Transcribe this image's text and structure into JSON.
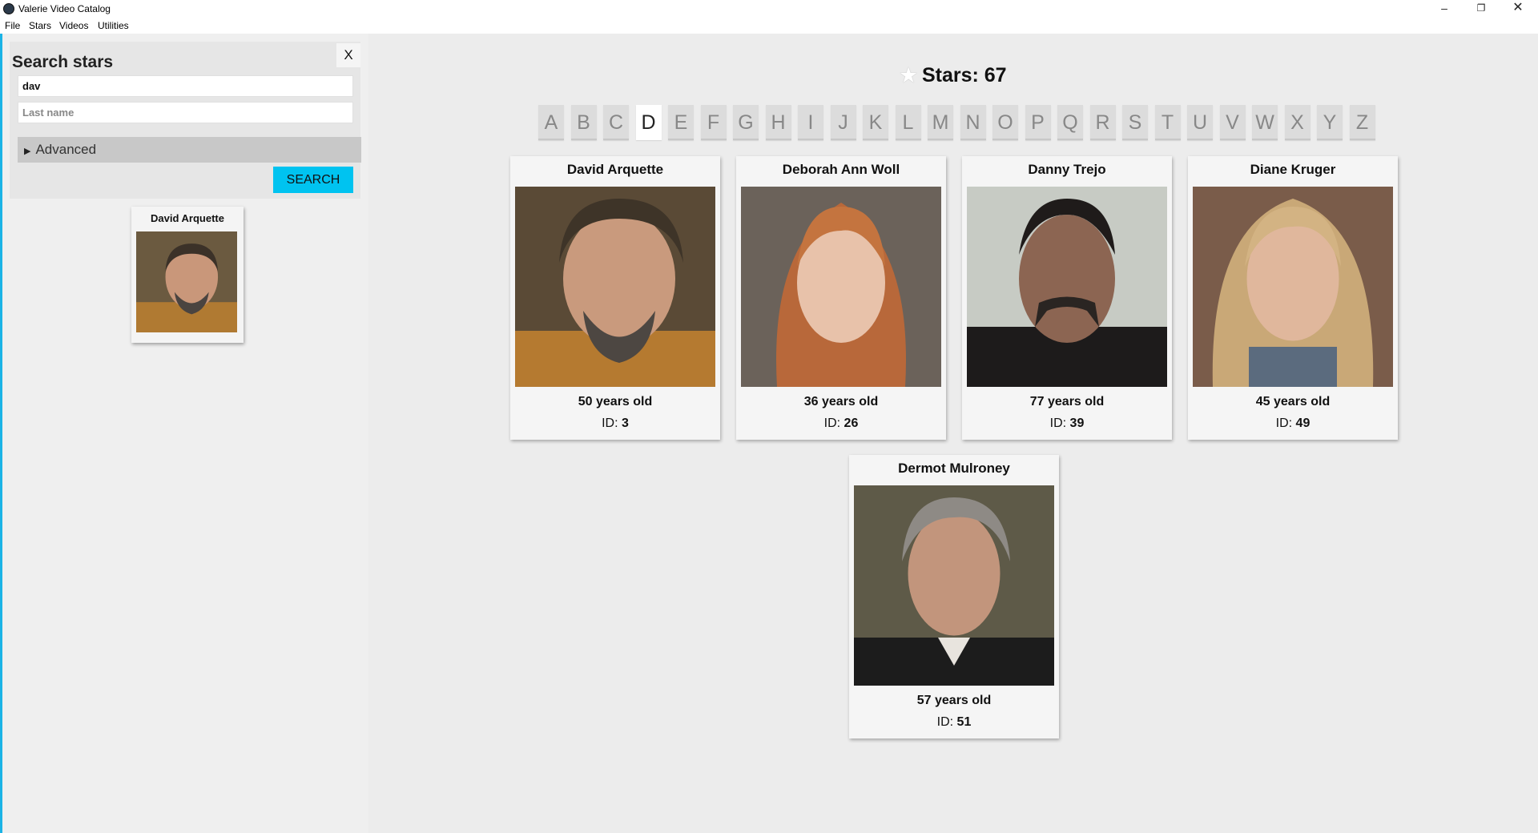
{
  "window": {
    "title": "Valerie Video Catalog",
    "minimize": "–",
    "maximize": "❐",
    "close": "✕"
  },
  "menu": [
    "File",
    "Stars",
    "Videos",
    "Utilities"
  ],
  "search": {
    "title": "Search stars",
    "close_label": "X",
    "first_name_value": "dav",
    "last_name_placeholder": "Last name",
    "advanced_label": "Advanced",
    "search_button": "SEARCH"
  },
  "search_results": [
    {
      "name": "David Arquette"
    }
  ],
  "header": {
    "label": "Stars: 67"
  },
  "letters": [
    "A",
    "B",
    "C",
    "D",
    "E",
    "F",
    "G",
    "H",
    "I",
    "J",
    "K",
    "L",
    "M",
    "N",
    "O",
    "P",
    "Q",
    "R",
    "S",
    "T",
    "U",
    "V",
    "W",
    "X",
    "Y",
    "Z"
  ],
  "active_letter": "D",
  "stars": [
    {
      "name": "David Arquette",
      "age": "50 years old",
      "id_label": "ID:",
      "id": "3"
    },
    {
      "name": "Deborah Ann Woll",
      "age": "36 years old",
      "id_label": "ID:",
      "id": "26"
    },
    {
      "name": "Danny Trejo",
      "age": "77 years old",
      "id_label": "ID:",
      "id": "39"
    },
    {
      "name": "Diane Kruger",
      "age": "45 years old",
      "id_label": "ID:",
      "id": "49"
    },
    {
      "name": "Dermot Mulroney",
      "age": "57 years old",
      "id_label": "ID:",
      "id": "51"
    }
  ],
  "colors": {
    "accent": "#00c3f0",
    "sidebar_border": "#1bb3e6"
  }
}
